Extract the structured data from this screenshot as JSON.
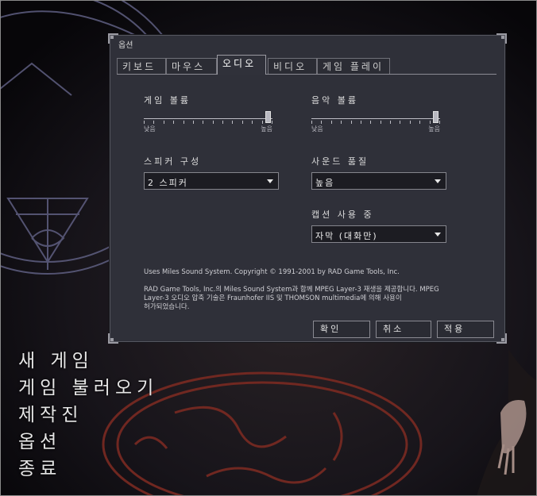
{
  "window": {
    "title": "옵션"
  },
  "tabs": [
    {
      "label": "키보드",
      "active": false
    },
    {
      "label": "마우스",
      "active": false
    },
    {
      "label": "오디오",
      "active": true
    },
    {
      "label": "비디오",
      "active": false
    },
    {
      "label": "게임 플레이",
      "active": false
    }
  ],
  "audio": {
    "game_volume": {
      "label": "게임 볼륨",
      "low": "낮음",
      "high": "높음",
      "value": 1.0
    },
    "music_volume": {
      "label": "음악 볼륨",
      "low": "낮음",
      "high": "높음",
      "value": 1.0
    },
    "speaker": {
      "label": "스피커 구성",
      "value": "2 스피커"
    },
    "sound_quality": {
      "label": "사운드 품질",
      "value": "높음"
    },
    "captions": {
      "label": "캡션 사용 중",
      "value": "자막 (대화만)"
    },
    "copyright1": "Uses Miles Sound System. Copyright © 1991-2001 by RAD Game Tools, Inc.",
    "copyright2_line1": "RAD Game Tools, Inc.의 Miles Sound System과 함께 MPEG Layer-3 재생을 제공합니다. MPEG",
    "copyright2_line2": "Layer-3 오디오 압축 기술은 Fraunhofer IIS 및 THOMSON multimedia에 의해 사용이",
    "copyright2_line3": "허가되었습니다."
  },
  "buttons": {
    "ok": "확인",
    "cancel": "취소",
    "apply": "적용"
  },
  "main_menu": [
    "새 게임",
    "게임 불러오기",
    "제작진",
    "옵션",
    "종료"
  ],
  "colors": {
    "dialog_bg": "#2f3039",
    "text": "#dcdcdc",
    "background": "#0d0c0f",
    "rune_red": "#7a2a22",
    "rune_blue": "#6a6a8a"
  }
}
